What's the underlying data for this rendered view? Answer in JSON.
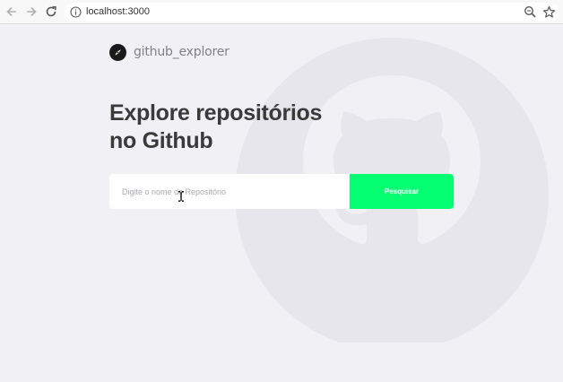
{
  "browser": {
    "url": "localhost:3000",
    "icons": [
      "back-arrow-icon",
      "forward-arrow-icon",
      "reload-icon",
      "info-icon",
      "zoom-icon",
      "star-icon"
    ]
  },
  "app": {
    "brand_name": "github_explorer",
    "headline_line1": "Explore repositórios",
    "headline_line2": "no Github",
    "search": {
      "placeholder": "Digite o nome do Repositório",
      "value": "",
      "button_label": "Pesquisar"
    }
  },
  "colors": {
    "background": "#f0f0f5",
    "button": "#04ff71",
    "headline": "#3a3a3a",
    "brand": "#808088"
  }
}
